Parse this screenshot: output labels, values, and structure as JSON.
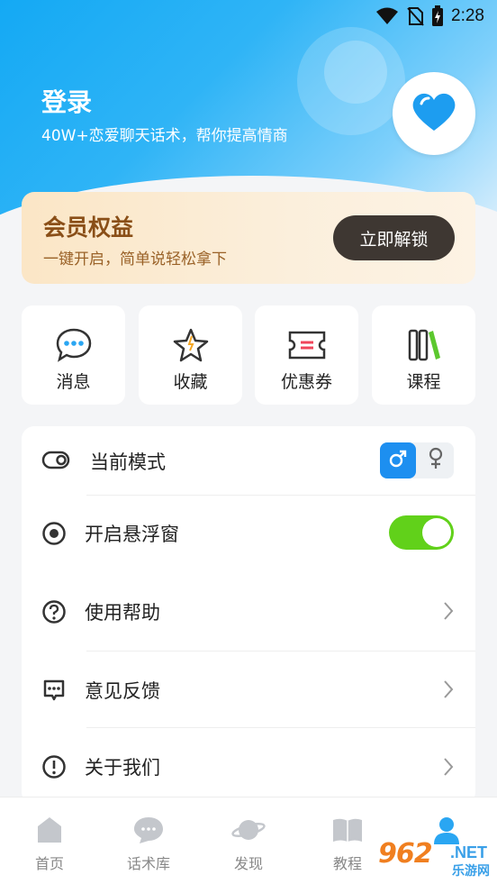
{
  "status_bar": {
    "time": "2:28"
  },
  "header": {
    "login_title": "登录",
    "login_subtitle": "40W+恋爱聊天话术，帮你提高情商"
  },
  "vip": {
    "title": "会员权益",
    "subtitle": "一键开启，简单说轻松拿下",
    "button": "立即解锁"
  },
  "quick_actions": [
    {
      "label": "消息",
      "icon": "message-bubble-icon"
    },
    {
      "label": "收藏",
      "icon": "star-icon"
    },
    {
      "label": "优惠券",
      "icon": "coupon-icon"
    },
    {
      "label": "课程",
      "icon": "books-icon"
    }
  ],
  "settings": {
    "mode": {
      "label": "当前模式",
      "selected": "male"
    },
    "float_window": {
      "label": "开启悬浮窗",
      "enabled": true
    },
    "help": {
      "label": "使用帮助"
    },
    "feedback": {
      "label": "意见反馈"
    },
    "about": {
      "label": "关于我们"
    }
  },
  "tabbar": [
    {
      "label": "首页",
      "icon": "home-icon"
    },
    {
      "label": "话术库",
      "icon": "chat-library-icon"
    },
    {
      "label": "发现",
      "icon": "planet-icon"
    },
    {
      "label": "教程",
      "icon": "book-icon"
    },
    {
      "label": "",
      "icon": "profile-icon",
      "active": true
    }
  ],
  "watermark": {
    "number": "962",
    "domain": ".NET",
    "brand": "乐游网"
  },
  "colors": {
    "primary_blue": "#1d8ff0",
    "vip_dark": "#3e3732",
    "vip_text": "#8a4f18",
    "switch_on": "#61d11a"
  }
}
